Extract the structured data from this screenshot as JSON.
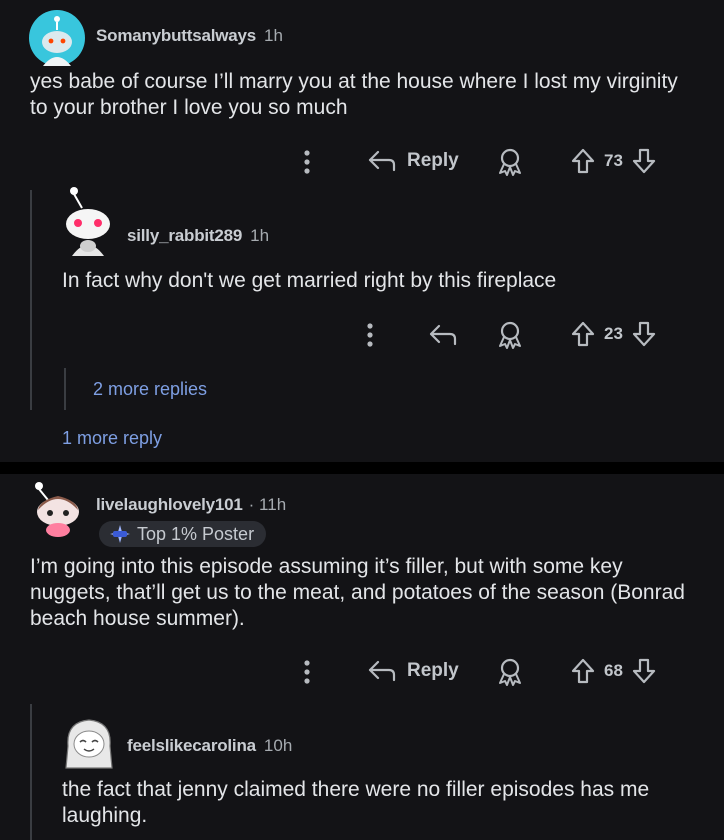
{
  "comments": [
    {
      "username": "Somanybuttsalways",
      "time": "1h",
      "body": "yes babe of course I’ll marry you at the house where I lost my virginity to your brother I love you so much",
      "reply_label": "Reply",
      "votes": "73"
    },
    {
      "username": "silly_rabbit289",
      "time": "1h",
      "body": "In fact why don't we get married right by this fireplace",
      "votes": "23",
      "more_replies": "2 more replies"
    },
    {
      "more_reply": "1 more reply"
    },
    {
      "username": "livelaughlovely101",
      "time": "· 11h",
      "badge": "Top 1% Poster",
      "body": "I’m going into this episode assuming it’s filler, but with some key nuggets, that’ll get us to the meat, and potatoes of the season (Bonrad beach house summer).",
      "reply_label": "Reply",
      "votes": "68"
    },
    {
      "username": "feelslikecarolina",
      "time": "10h",
      "body": "the fact that jenny claimed there were no filler episodes has me laughing."
    }
  ],
  "colors": {
    "background": "#131316",
    "separator": "#000000",
    "link": "#7e9fe3"
  },
  "icons": [
    "snoo-avatar-icon",
    "more-options-icon",
    "reply-arrow-icon",
    "award-icon",
    "upvote-icon",
    "downvote-icon",
    "sparkle-badge-icon"
  ]
}
